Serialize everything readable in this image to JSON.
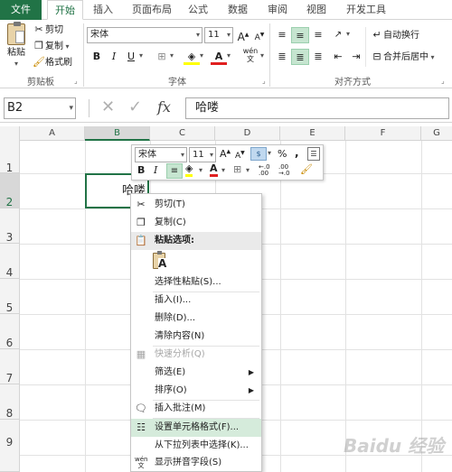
{
  "tabs": [
    "文件",
    "开始",
    "插入",
    "页面布局",
    "公式",
    "数据",
    "审阅",
    "视图",
    "开发工具"
  ],
  "clipboard": {
    "paste": "粘贴",
    "cut": "剪切",
    "copy": "复制",
    "format_painter": "格式刷",
    "label": "剪贴板"
  },
  "font": {
    "name": "宋体",
    "size": "11",
    "label": "字体",
    "bold": "B",
    "italic": "I",
    "underline": "U",
    "grow": "A",
    "shrink": "A"
  },
  "alignment": {
    "wrap": "自动换行",
    "merge": "合并后居中",
    "label": "对齐方式"
  },
  "formula_bar": {
    "name_box": "B2",
    "cancel": "✕",
    "enter": "✓",
    "fx": "fx",
    "content": "哈喽"
  },
  "columns": [
    "A",
    "B",
    "C",
    "D",
    "E",
    "F",
    "G"
  ],
  "rows": [
    "1",
    "2",
    "3",
    "4",
    "5",
    "6",
    "7",
    "8",
    "9"
  ],
  "cell": {
    "address": "B2",
    "value": "哈喽"
  },
  "mini_toolbar": {
    "font": "宋体",
    "size": "11",
    "percent": "%",
    "comma": ","
  },
  "context_menu": {
    "cut": "剪切(T)",
    "copy": "复制(C)",
    "paste_options": "粘贴选项:",
    "paste_special": "选择性粘贴(S)...",
    "insert": "插入(I)...",
    "delete": "删除(D)...",
    "clear": "清除内容(N)",
    "quick_analysis": "快速分析(Q)",
    "filter": "筛选(E)",
    "sort": "排序(O)",
    "insert_comment": "插入批注(M)",
    "format_cells": "设置单元格格式(F)...",
    "pick_list": "从下拉列表中选择(K)...",
    "phonetic": "显示拼音字段(S)"
  },
  "watermark": "Baidu 经验"
}
